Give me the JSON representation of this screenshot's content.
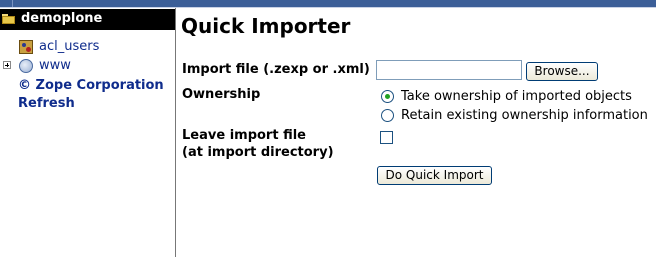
{
  "tree": {
    "root_label": "demoplone",
    "items": [
      {
        "label": "acl_users",
        "icon": "users-folder-icon"
      },
      {
        "label": "www",
        "icon": "globe-icon",
        "expandable": true
      }
    ],
    "copyright_link": "© Zope Corporation",
    "refresh_link": "Refresh"
  },
  "main": {
    "title": "Quick Importer",
    "import_file_label": "Import file (.zexp or .xml)",
    "import_file_value": "",
    "browse_label": "Browse...",
    "ownership_label": "Ownership",
    "ownership_options": [
      {
        "label": "Take ownership of imported objects",
        "checked": true
      },
      {
        "label": "Retain existing ownership information",
        "checked": false
      }
    ],
    "leave_file_label_line1": "Leave import file",
    "leave_file_label_line2": "(at import directory)",
    "leave_file_checked": false,
    "submit_label": "Do Quick Import"
  },
  "colors": {
    "link": "#0f2c8c",
    "header_bg": "#000000",
    "topbar": "#3c5f98"
  }
}
